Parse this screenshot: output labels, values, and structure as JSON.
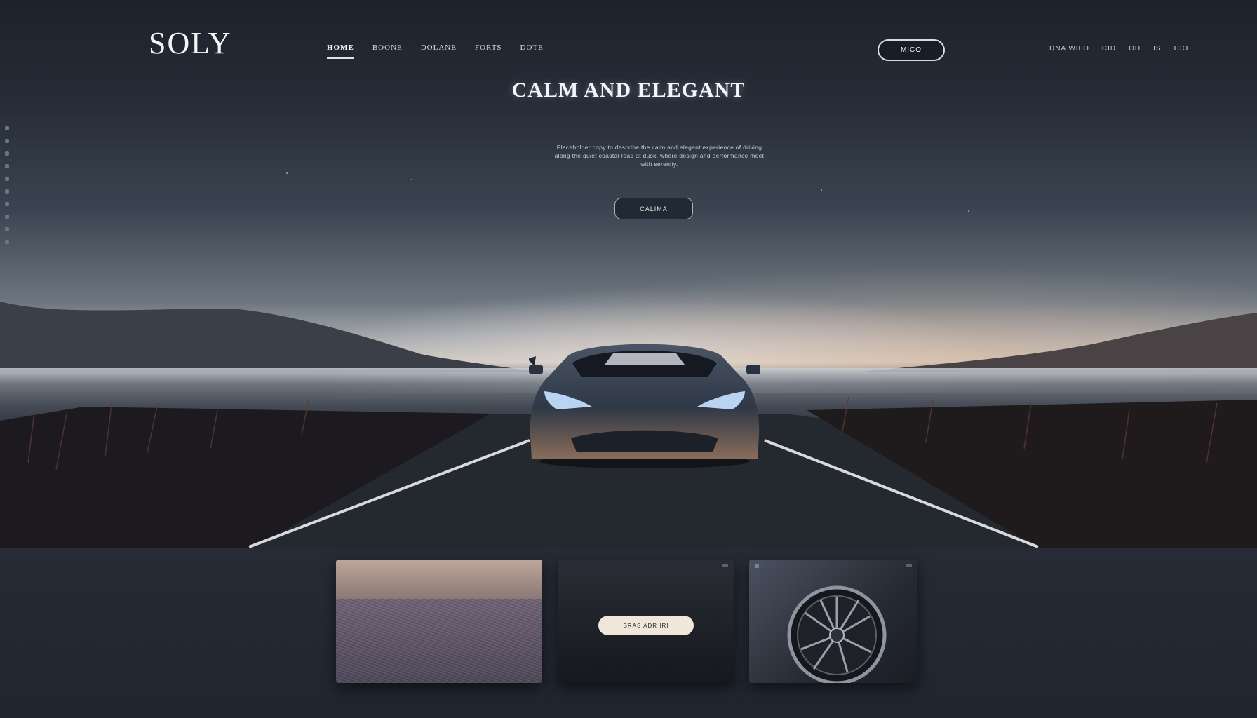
{
  "brand": {
    "name": "SOLY"
  },
  "nav": {
    "items": [
      {
        "label": "HOME",
        "active": true
      },
      {
        "label": "BOONE"
      },
      {
        "label": "DOLANE"
      },
      {
        "label": "FORTS"
      },
      {
        "label": "DOTE"
      }
    ]
  },
  "header": {
    "button_label": "MICO",
    "utility_links": [
      "DNA WILO",
      "CID",
      "OD",
      "IS",
      "CIO"
    ]
  },
  "hero": {
    "title": "CALM AND ELEGANT",
    "description": "Placeholder copy to describe the calm and elegant experience of driving along the quiet coastal road at dusk, where design and performance meet with serenity.",
    "cta_label": "CALIMA"
  },
  "cards": [
    {
      "name": "texture-card"
    },
    {
      "name": "promo-card",
      "pill_label": "SRAS ADR IRI"
    },
    {
      "name": "wheel-card"
    }
  ],
  "colors": {
    "background": "#1f2430",
    "accent": "#dfe4ea",
    "pill": "#efe7da"
  }
}
